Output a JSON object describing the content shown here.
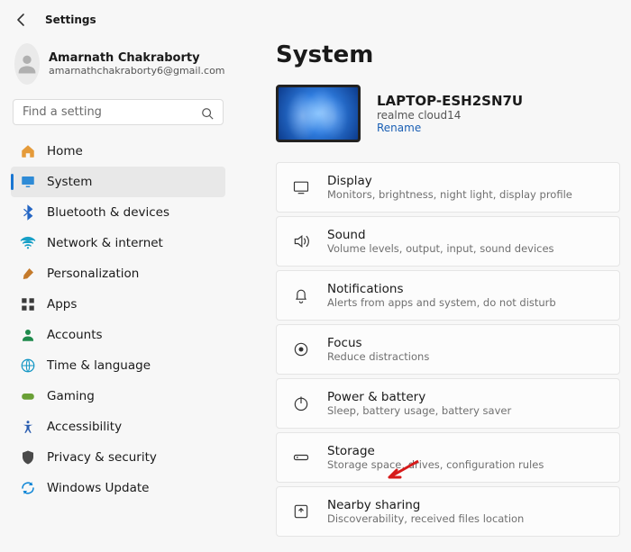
{
  "header": {
    "title": "Settings"
  },
  "profile": {
    "name": "Amarnath Chakraborty",
    "email": "amarnathchakraborty6@gmail.com"
  },
  "search": {
    "placeholder": "Find a setting"
  },
  "sidebar": {
    "items": [
      {
        "label": "Home"
      },
      {
        "label": "System"
      },
      {
        "label": "Bluetooth & devices"
      },
      {
        "label": "Network & internet"
      },
      {
        "label": "Personalization"
      },
      {
        "label": "Apps"
      },
      {
        "label": "Accounts"
      },
      {
        "label": "Time & language"
      },
      {
        "label": "Gaming"
      },
      {
        "label": "Accessibility"
      },
      {
        "label": "Privacy & security"
      },
      {
        "label": "Windows Update"
      }
    ]
  },
  "main": {
    "page_title": "System",
    "device": {
      "name": "LAPTOP-ESH2SN7U",
      "model": "realme cloud14",
      "rename_label": "Rename"
    },
    "settings": [
      {
        "title": "Display",
        "sub": "Monitors, brightness, night light, display profile"
      },
      {
        "title": "Sound",
        "sub": "Volume levels, output, input, sound devices"
      },
      {
        "title": "Notifications",
        "sub": "Alerts from apps and system, do not disturb"
      },
      {
        "title": "Focus",
        "sub": "Reduce distractions"
      },
      {
        "title": "Power & battery",
        "sub": "Sleep, battery usage, battery saver"
      },
      {
        "title": "Storage",
        "sub": "Storage space, drives, configuration rules"
      },
      {
        "title": "Nearby sharing",
        "sub": "Discoverability, received files location"
      }
    ]
  }
}
